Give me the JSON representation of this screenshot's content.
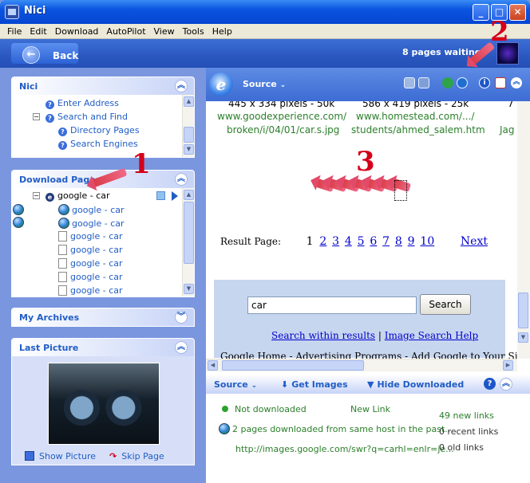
{
  "window": {
    "title": "Nici"
  },
  "menu": [
    "File",
    "Edit",
    "Download",
    "AutoPilot",
    "View",
    "Tools",
    "Help"
  ],
  "nav": {
    "back_label": "Back",
    "pages_waiting": "8 pages waiting"
  },
  "panels": {
    "nici": {
      "title": "Nici",
      "items": [
        "Enter Address",
        "Search and Find",
        "Directory Pages",
        "Search Engines"
      ]
    },
    "download_pages": {
      "title": "Download Pages",
      "root": "google - car",
      "items": [
        "google - car",
        "google - car",
        "google - car",
        "google - car",
        "google - car",
        "google - car",
        "google - car"
      ]
    },
    "my_archives": {
      "title": "My Archives"
    },
    "last_picture": {
      "title": "Last Picture",
      "show_label": "Show Picture",
      "skip_label": "Skip Page"
    }
  },
  "annotations": {
    "one": "1",
    "two": "2",
    "three": "3"
  },
  "browser": {
    "source_label": "Source",
    "captions": {
      "left_dims": "445 x 334 pixels - 50k",
      "right_dims": "586 x 419 pixels - 25k",
      "far_right": "7",
      "left_url1": "www.goodexperience.com/",
      "left_url2": "broken/i/04/01/car.s.jpg",
      "right_url1": "www.homestead.com/.../",
      "right_url2": "students/ahmed_salem.htm",
      "far_right2": "Jag"
    },
    "result_page_label": "Result Page:",
    "current_page": "1",
    "pages": [
      "2",
      "3",
      "4",
      "5",
      "6",
      "7",
      "8",
      "9",
      "10"
    ],
    "next_label": "Next",
    "search_value": "car",
    "search_button": "Search",
    "search_within": "Search within results",
    "separator": "|",
    "image_search_help": "Image Search Help",
    "bottom_text": "Google Home - Advertising Programs - Add Google to Your Site"
  },
  "bottom": {
    "source_label": "Source",
    "get_images": "Get Images",
    "hide_downloaded": "Hide Downloaded",
    "not_downloaded": "Not downloaded",
    "new_link": "New Link",
    "pages_downloaded": "2 pages downloaded from same host in the past...",
    "url": "http://images.google.com/swr?q=carhl=enlr=je...",
    "new_links": "49 new links",
    "recent_links": "0 recent links",
    "old_links": "0 old links"
  },
  "colors": {
    "title_blue": "#0a54e0",
    "panel_link": "#215dc6",
    "green_text": "#2b7f2b",
    "annotation_red": "#d4001a"
  }
}
